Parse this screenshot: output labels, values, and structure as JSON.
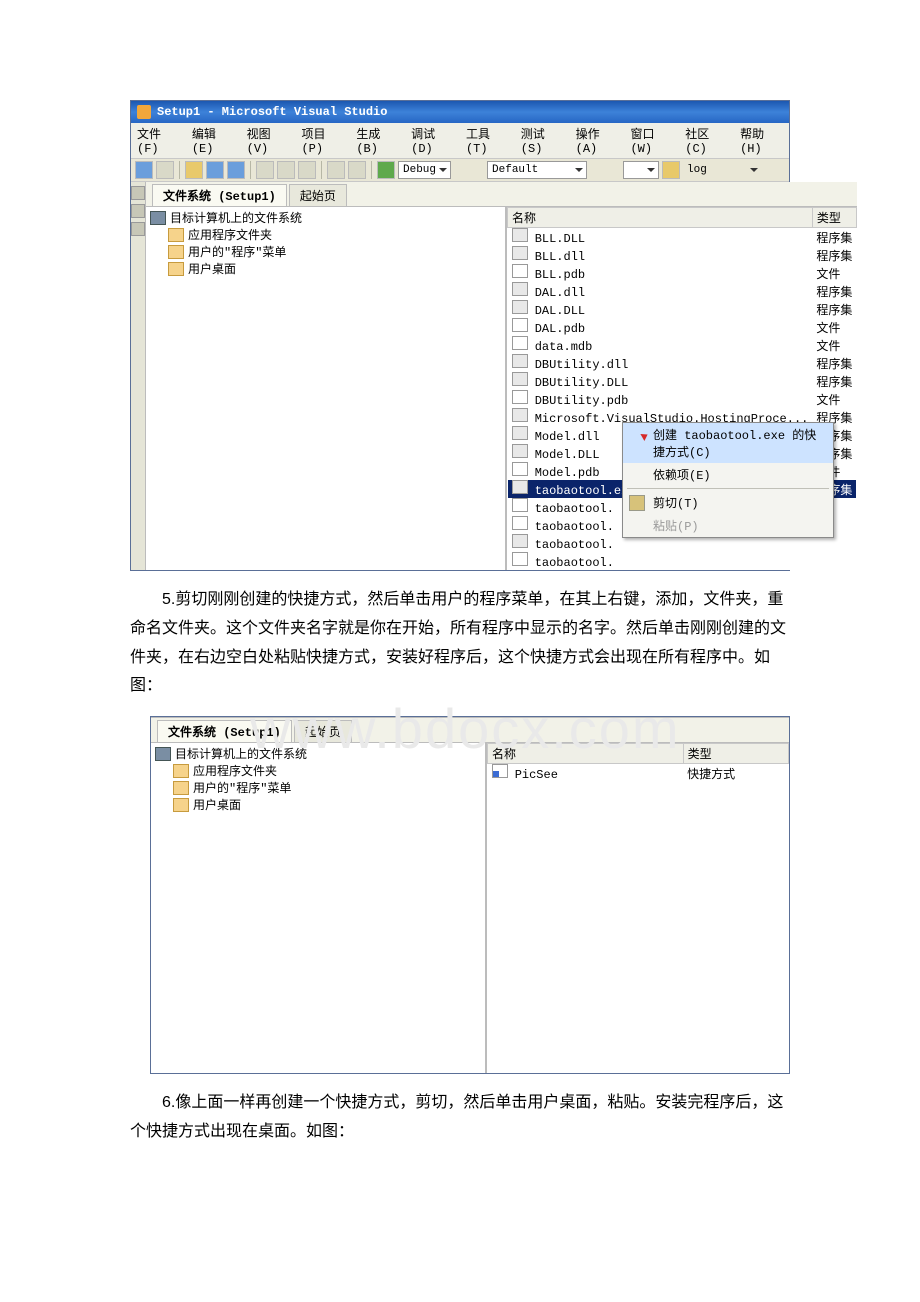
{
  "doc": {
    "para1": "5.剪切刚刚创建的快捷方式，然后单击用户的程序菜单，在其上右键，添加，文件夹，重命名文件夹。这个文件夹名字就是你在开始，所有程序中显示的名字。然后单击刚刚创建的文件夹，在右边空白处粘贴快捷方式，安装好程序后，这个快捷方式会出现在所有程序中。如图：",
    "para2": "6.像上面一样再创建一个快捷方式，剪切，然后单击用户桌面，粘贴。安装完程序后，这个快捷方式出现在桌面。如图：",
    "watermark": "www.bdocx.com"
  },
  "vs": {
    "title": "Setup1 - Microsoft Visual Studio",
    "menu": {
      "file": "文件(F)",
      "edit": "编辑(E)",
      "view": "视图(V)",
      "project": "项目(P)",
      "build": "生成(B)",
      "debug": "调试(D)",
      "tools": "工具(T)",
      "test": "测试(S)",
      "action": "操作(A)",
      "window": "窗口(W)",
      "community": "社区(C)",
      "help": "帮助(H)"
    },
    "toolbar": {
      "debug": "Debug",
      "default": "Default",
      "log": "log"
    },
    "tabs": {
      "active": "文件系统 (Setup1)",
      "inactive": "起始页"
    },
    "tree": {
      "root": "目标计算机上的文件系统",
      "app": "应用程序文件夹",
      "menu": "用户的\"程序\"菜单",
      "desktop": "用户桌面"
    },
    "cols": {
      "name": "名称",
      "type": "类型"
    }
  },
  "files": [
    {
      "name": "BLL.DLL",
      "type": "程序集",
      "icon": "asm"
    },
    {
      "name": "BLL.dll",
      "type": "程序集",
      "icon": "asm"
    },
    {
      "name": "BLL.pdb",
      "type": "文件",
      "icon": "file"
    },
    {
      "name": "DAL.dll",
      "type": "程序集",
      "icon": "asm"
    },
    {
      "name": "DAL.DLL",
      "type": "程序集",
      "icon": "asm"
    },
    {
      "name": "DAL.pdb",
      "type": "文件",
      "icon": "file"
    },
    {
      "name": "data.mdb",
      "type": "文件",
      "icon": "file"
    },
    {
      "name": "DBUtility.dll",
      "type": "程序集",
      "icon": "asm"
    },
    {
      "name": "DBUtility.DLL",
      "type": "程序集",
      "icon": "asm"
    },
    {
      "name": "DBUtility.pdb",
      "type": "文件",
      "icon": "file"
    },
    {
      "name": "Microsoft.VisualStudio.HostingProce...",
      "type": "程序集",
      "icon": "asm"
    },
    {
      "name": "Model.dll",
      "type": "程序集",
      "icon": "asm"
    },
    {
      "name": "Model.DLL",
      "type": "程序集",
      "icon": "asm"
    },
    {
      "name": "Model.pdb",
      "type": "文件",
      "icon": "file"
    },
    {
      "name": "taobaotool.exe",
      "type": "程序集",
      "icon": "asm",
      "selected": true
    },
    {
      "name": "taobaotool.",
      "type": "",
      "icon": "file"
    },
    {
      "name": "taobaotool.",
      "type": "",
      "icon": "file"
    },
    {
      "name": "taobaotool.",
      "type": "",
      "icon": "asm"
    },
    {
      "name": "taobaotool.",
      "type": "",
      "icon": "file"
    }
  ],
  "ctx": {
    "create": "创建 taobaotool.exe 的快捷方式(C)",
    "depend": "依赖项(E)",
    "cut": "剪切(T)",
    "paste": "粘贴(P)"
  },
  "shot2": {
    "file": {
      "name": "PicSee",
      "type": "快捷方式"
    }
  }
}
